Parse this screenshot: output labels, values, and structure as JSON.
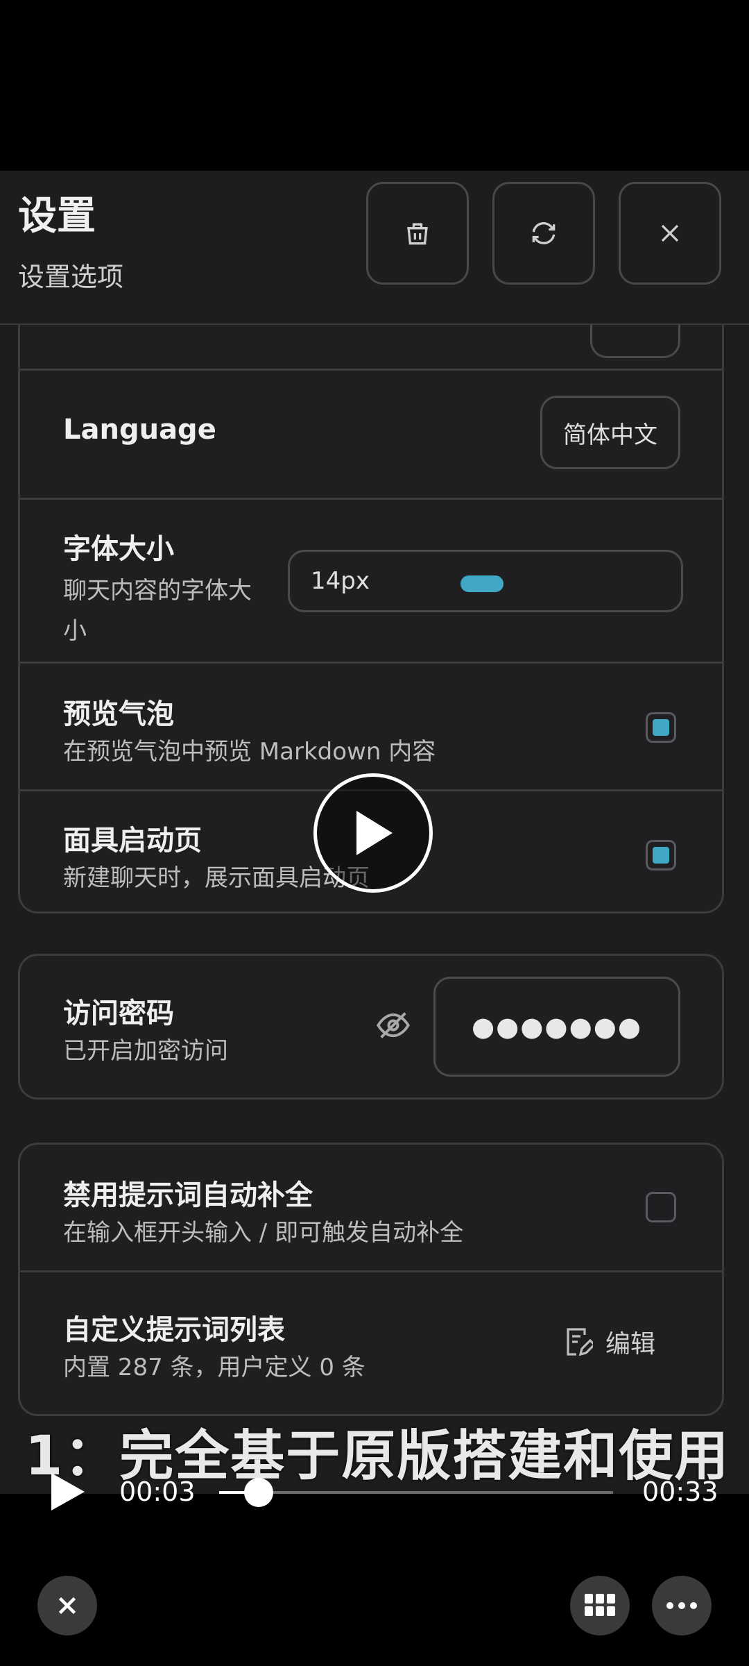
{
  "header": {
    "title": "设置",
    "subtitle": "设置选项"
  },
  "language": {
    "label": "Language",
    "value": "简体中文"
  },
  "font_size": {
    "title": "字体大小",
    "subtitle": "聊天内容的字体大小",
    "value": "14px",
    "level": 0.4
  },
  "preview_bubble": {
    "title": "预览气泡",
    "subtitle": "在预览气泡中预览 Markdown 内容",
    "checked": true
  },
  "mask_launch": {
    "title": "面具启动页",
    "subtitle": "新建聊天时，展示面具启动页",
    "checked": true
  },
  "access_password": {
    "title": "访问密码",
    "subtitle": "已开启加密访问",
    "value": "●●●●●●●"
  },
  "disable_autocomplete": {
    "title": "禁用提示词自动补全",
    "subtitle": "在输入框开头输入 / 即可触发自动补全",
    "checked": false
  },
  "custom_prompts": {
    "title": "自定义提示词列表",
    "subtitle": "内置 287 条，用户定义 0 条",
    "edit_label": "编辑"
  },
  "video": {
    "subtitle": "1：完全基于原版搭建和使用",
    "current_time": "00:03",
    "duration": "00:33",
    "progress": 0.1
  },
  "colors": {
    "accent": "#40a8c4",
    "background": "#1d1d1f",
    "border": "#3c3c3f"
  }
}
